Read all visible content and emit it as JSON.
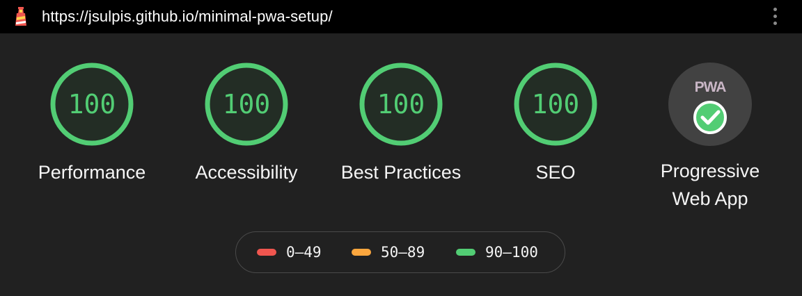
{
  "browser": {
    "url": "https://jsulpis.github.io/minimal-pwa-setup/",
    "logo_icon": "lighthouse-icon",
    "menu_icon": "more-vert-icon"
  },
  "categories": [
    {
      "label": "Performance",
      "score": "100"
    },
    {
      "label": "Accessibility",
      "score": "100"
    },
    {
      "label": "Best Practices",
      "score": "100"
    },
    {
      "label": "SEO",
      "score": "100"
    }
  ],
  "pwa": {
    "badge_text": "PWA",
    "label_line1": "Progressive",
    "label_line2": "Web App",
    "status_icon": "check-circle-icon"
  },
  "legend": [
    {
      "range": "0–49",
      "color": "#f0564f"
    },
    {
      "range": "50–89",
      "color": "#fca73e"
    },
    {
      "range": "90–100",
      "color": "#52cd74"
    }
  ],
  "colors": {
    "pass": "#52cd74",
    "background": "#212121",
    "topbar": "#000000"
  }
}
